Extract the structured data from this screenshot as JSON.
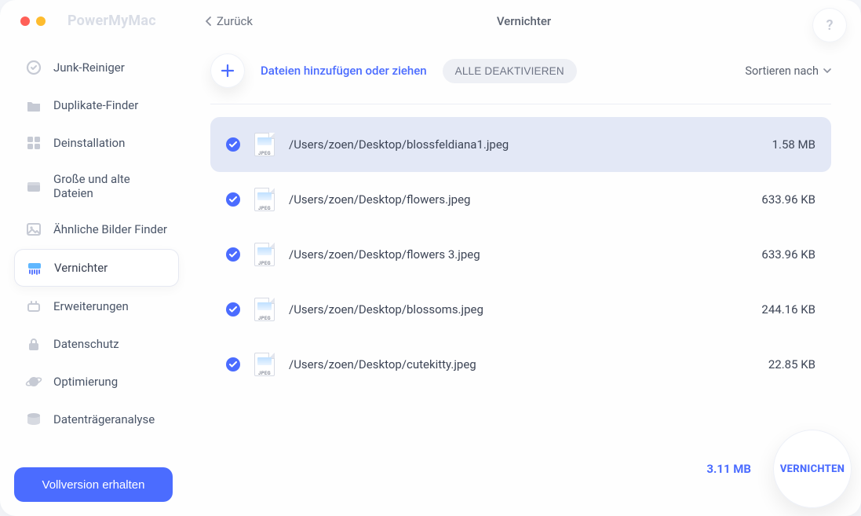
{
  "app_name": "PowerMyMac",
  "header": {
    "back_label": "Zurück",
    "page_title": "Vernichter",
    "help_label": "?"
  },
  "toolbar": {
    "add_hint": "Dateien hinzufügen oder ziehen",
    "deactivate_all": "ALLE DEAKTIVIEREN",
    "sort_label": "Sortieren nach"
  },
  "sidebar": {
    "full_version_label": "Vollversion erhalten",
    "items": [
      {
        "label": "Junk-Reiniger",
        "icon": "junk"
      },
      {
        "label": "Duplikate-Finder",
        "icon": "folder"
      },
      {
        "label": "Deinstallation",
        "icon": "apps"
      },
      {
        "label": "Große und alte Dateien",
        "icon": "box"
      },
      {
        "label": "Ähnliche Bilder Finder",
        "icon": "image"
      },
      {
        "label": "Vernichter",
        "icon": "shredder",
        "active": true
      },
      {
        "label": "Erweiterungen",
        "icon": "plugin"
      },
      {
        "label": "Datenschutz",
        "icon": "lock"
      },
      {
        "label": "Optimierung",
        "icon": "planet"
      },
      {
        "label": "Datenträgeranalyse",
        "icon": "disk"
      }
    ]
  },
  "files": [
    {
      "path": "/Users/zoen/Desktop/blossfeldiana1.jpeg",
      "size": "1.58 MB",
      "checked": true,
      "selected": true,
      "type": "JPEG"
    },
    {
      "path": "/Users/zoen/Desktop/flowers.jpeg",
      "size": "633.96 KB",
      "checked": true,
      "selected": false,
      "type": "JPEG"
    },
    {
      "path": "/Users/zoen/Desktop/flowers 3.jpeg",
      "size": "633.96 KB",
      "checked": true,
      "selected": false,
      "type": "JPEG"
    },
    {
      "path": "/Users/zoen/Desktop/blossoms.jpeg",
      "size": "244.16 KB",
      "checked": true,
      "selected": false,
      "type": "JPEG"
    },
    {
      "path": "/Users/zoen/Desktop/cutekitty.jpeg",
      "size": "22.85 KB",
      "checked": true,
      "selected": false,
      "type": "JPEG"
    }
  ],
  "footer": {
    "total_size": "3.11 MB",
    "action_label": "VERNICHTEN"
  }
}
